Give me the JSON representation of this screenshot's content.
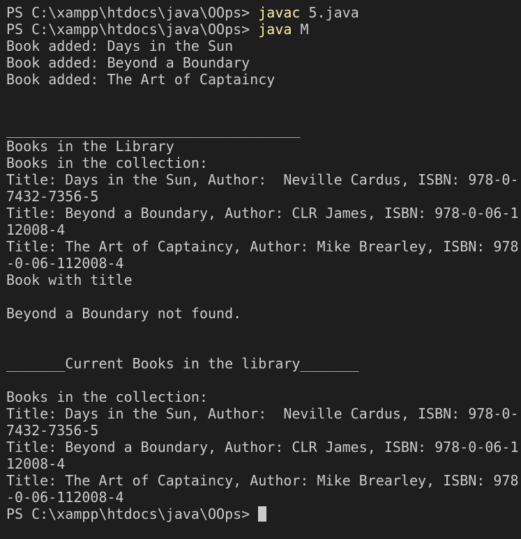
{
  "colors": {
    "background": "#1e1e1e",
    "foreground": "#cccccc",
    "command": "#f9f1a5",
    "cursor": "#cccccc"
  },
  "terminal": {
    "prompt": "PS C:\\xampp\\htdocs\\java\\OOps> ",
    "commands": [
      {
        "name": "javac",
        "args": " 5.java"
      },
      {
        "name": "java",
        "args": " M"
      }
    ],
    "output": [
      "Book added: Days in the Sun",
      "Book added: Beyond a Boundary",
      "Book added: The Art of Captaincy",
      "",
      "",
      "___________________________________",
      "Books in the Library",
      "Books in the collection:",
      "Title: Days in the Sun, Author:  Neville Cardus, ISBN: 978-0-",
      "7432-7356-5",
      "Title: Beyond a Boundary, Author: CLR James, ISBN: 978-0-06-1",
      "12008-4",
      "Title: The Art of Captaincy, Author: Mike Brearley, ISBN: 978",
      "-0-06-112008-4",
      "Book with title",
      "",
      "Beyond a Boundary not found.",
      "",
      "",
      "_______Current Books in the library_______",
      "",
      "Books in the collection:",
      "Title: Days in the Sun, Author:  Neville Cardus, ISBN: 978-0-",
      "7432-7356-5",
      "Title: Beyond a Boundary, Author: CLR James, ISBN: 978-0-06-1",
      "12008-4",
      "Title: The Art of Captaincy, Author: Mike Brearley, ISBN: 978",
      "-0-06-112008-4"
    ]
  }
}
